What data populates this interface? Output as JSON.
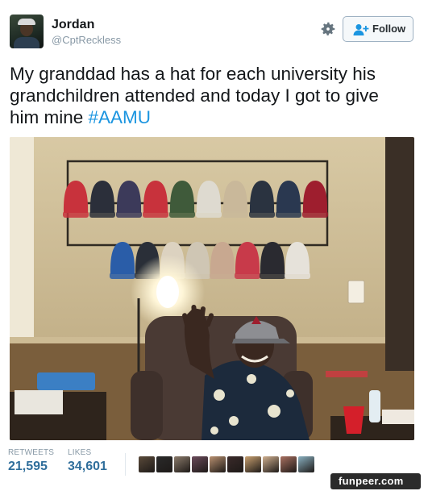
{
  "user": {
    "name": "Jordan",
    "handle": "@CptReckless"
  },
  "follow_button": {
    "label": "Follow",
    "icon": "add-user-icon"
  },
  "settings_icon": "gear-icon",
  "tweet": {
    "text": "My granddad has a hat for each university his grandchildren attended and today I got to give him mine ",
    "hashtag": "#AAMU"
  },
  "photo": {
    "hats_row1_colors": [
      "#c8323c",
      "#2b2f3a",
      "#3c3a5a",
      "#c8323c",
      "#3f5a3a",
      "#dedad0",
      "#c9b89a",
      "#2a3340",
      "#2a3850",
      "#9e1e2e"
    ],
    "hats_row2_colors": [
      "#2a5da8",
      "#2a2f38",
      "#dcd2c0",
      "#cfc6b4",
      "#c8a890",
      "#c83a4a",
      "#2a2a30",
      "#e6e2da"
    ]
  },
  "stats": {
    "retweets_label": "RETWEETS",
    "retweets_value": "21,595",
    "likes_label": "LIKES",
    "likes_value": "34,601"
  },
  "likers": [
    "#5a4a3a",
    "#2a2a2a",
    "#8a7a6a",
    "#6a4a5a",
    "#b89070",
    "#3a2a2a",
    "#c8a070",
    "#d0b090",
    "#a87060",
    "#8ab0c0"
  ],
  "watermark": "funpeer.com",
  "colors": {
    "link": "#1b95e0",
    "stat_value": "#2f6e9b",
    "meta_gray": "#8899a6"
  }
}
